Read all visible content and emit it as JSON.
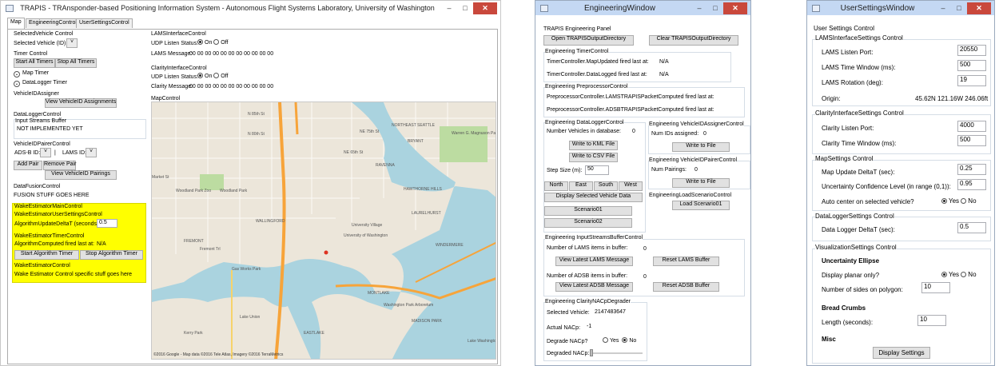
{
  "main": {
    "title": "TRAPIS - TRAnsponder-based Positioning Information System - Autonomous Flight Systems Laboratory, University of Washington",
    "controls": {
      "min": "–",
      "max": "□",
      "close": "✕"
    },
    "tabs": [
      "Map",
      "EngineeringControl",
      "UserSettingsControl"
    ],
    "selected_vehicle": {
      "header": "SelectedVehicle Control",
      "label": "Selected Vehicle (ID):"
    },
    "timer": {
      "header": "Timer Control",
      "start": "Start All Timers",
      "stop": "Stop All Timers",
      "map_timer": "Map Timer",
      "datalogger_timer": "DataLogger Timer"
    },
    "assigner": {
      "header": "VehicleIDAssigner",
      "button": "View VehicleID Assignments"
    },
    "datalogger": {
      "header": "DataLoggerControl",
      "sub": "Input Streams Buffer",
      "text": "NOT IMPLEMENTED YET"
    },
    "pairer": {
      "header": "VehicleIDPairerControl",
      "adsb": "ADS-B ID:",
      "sep": "|",
      "lams": "LAMS ID:",
      "add": "Add Pair",
      "remove": "Remove Pair",
      "view": "View VehicleID Pairings"
    },
    "fusion": {
      "header": "DataFusionControl",
      "text": "FUSION STUFF GOES HERE"
    },
    "wake": {
      "header": "WakeEstimatorMainControl",
      "user_header": "WakeEstimatorUserSettingsControl",
      "delta_label": "AlgorithmUpdateDeltaT (seconds):",
      "delta_value": "0.5",
      "timer_header": "WakeEstimatorTimerControl",
      "computed_label": "AlgorithmComputed fired last at:",
      "computed_value": "N/A",
      "start": "Start Algorithm Timer",
      "stop": "Stop Algorithm Timer",
      "control_header": "WakeEstimatorControl",
      "control_text": "Wake Estimator Control specific stuff goes here"
    },
    "lams": {
      "header": "LAMSInterfaceControl",
      "status_label": "UDP Listen Status:",
      "on": "On",
      "off": "Off",
      "msg_label": "LAMS Message:",
      "msg_value": "00 00 00 00 00 00 00 00 00 00 00"
    },
    "clarity": {
      "header": "ClarityInterfaceControl",
      "status_label": "UDP Listen Status:",
      "on": "On",
      "off": "Off",
      "msg_label": "Clarity Message:",
      "msg_value": "00 00 00 00 00 00 00 00 00 00 00"
    },
    "map": {
      "header": "MapControl",
      "attribution": "©2016 Google - Map data ©2016 Tele Atlas, Imagery ©2016 TerraMetrics",
      "labels": [
        "N 85th St",
        "N 80th St",
        "NE 75th St",
        "NORTHEAST SEATTLE",
        "Warren G. Magnuson Park",
        "NE 65th St",
        "RAVENNA",
        "Market St",
        "Woodland Park Zoo",
        "Woodland Park",
        "FREMONT",
        "WALLINGFORD",
        "University Village",
        "University of Washington",
        "Fremont Trl",
        "Gas Works Park",
        "Lake Union",
        "EASTLAKE",
        "MONTLAKE",
        "Washington Park Arboretum",
        "MADISON PARK",
        "Kerry Park",
        "Lake Washington",
        "LAURELHURST",
        "WINDERMERE",
        "BRYANT",
        "HAWTHORNE HILLS"
      ]
    }
  },
  "eng": {
    "title": "EngineeringWindow",
    "panel": "TRAPIS Engineering Panel",
    "open_dir": "Open TRAPISOutputDirectory",
    "clear_dir": "Clear TRAPISOutputDirectory",
    "timer": {
      "header": "Engineering TimerControl",
      "map_label": "TimerController.MapUpdated fired last at:",
      "map_value": "N/A",
      "log_label": "TimerController.DataLogged fired last at:",
      "log_value": "N/A"
    },
    "pre": {
      "header": "Engineering PreprocessorControl",
      "lams": "PreprocessorController.LAMSTRAPISPacketComputed fired last at:",
      "adsb": "PreprocessorController.ADSBTRAPISPacketComputed fired last at:"
    },
    "dl": {
      "header": "Engineering DataLoggerControl",
      "num_label": "Number Vehicles in database:",
      "num_value": "0",
      "kml": "Write to KML File",
      "csv": "Write to CSV File",
      "step_label": "Step Size (m):",
      "step_value": "50",
      "north": "North",
      "east": "East",
      "south": "South",
      "west": "West",
      "display": "Display Selected Vehicle Data",
      "s1": "Scenario01",
      "s2": "Scenario02"
    },
    "assign": {
      "header": "Engineering VehicleIDAssignerControl",
      "label": "Num IDs assigned:",
      "value": "0",
      "write": "Write to File"
    },
    "pair": {
      "header": "Engineering VehicleIDPairerControl",
      "label": "Num Pairings:",
      "value": "0",
      "write": "Write to File"
    },
    "load": {
      "header": "EngineeringLoadScenarioControl",
      "button": "Load Scenario01"
    },
    "streams": {
      "header": "Engineering InputStreamsBufferControl",
      "lams_label": "Number of LAMS items in buffer:",
      "lams_value": "0",
      "view_lams": "View Latest LAMS Message",
      "reset_lams": "Reset LAMS Buffer",
      "adsb_label": "Number of ADSB items in buffer:",
      "adsb_value": "0",
      "view_adsb": "View Latest ADSB Message",
      "reset_adsb": "Reset ADSB Buffer"
    },
    "nac": {
      "header": "Engineering ClarityNACpDegrader",
      "sel_label": "Selected Vehicle:",
      "sel_value": "2147483647",
      "actual_label": "Actual NACp:",
      "actual_value": "-1",
      "degrade_label": "Degrade NACp?",
      "yes": "Yes",
      "no": "No",
      "degraded_label": "Degraded NACp:"
    }
  },
  "user": {
    "title": "UserSettingsWindow",
    "root": "User Settings Control",
    "lams": {
      "header": "LAMSInterfaceSettings Control",
      "port_label": "LAMS Listen Port:",
      "port_value": "20550",
      "window_label": "LAMS Time Window (ms):",
      "window_value": "500",
      "rot_label": "LAMS Rotation (deg):",
      "rot_value": "19",
      "origin_label": "Origin:",
      "origin_value": "45.62N 121.16W 246.06ft"
    },
    "clarity": {
      "header": "ClarityInterfaceSettings Control",
      "port_label": "Clarity Listen Port:",
      "port_value": "4000",
      "window_label": "Clarity Time Window (ms):",
      "window_value": "500"
    },
    "map": {
      "header": "MapSettings Control",
      "delta_label": "Map Update DeltaT (sec):",
      "delta_value": "0.25",
      "conf_label": "Uncertainty Confidence Level (in range (0,1)):",
      "conf_value": "0.95",
      "auto_label": "Auto center on selected vehicle?",
      "yes": "Yes",
      "no": "No"
    },
    "dl": {
      "header": "DataLoggerSettings Control",
      "delta_label": "Data Logger DeltaT (sec):",
      "delta_value": "0.5"
    },
    "vis": {
      "header": "VisualizationSettings Control",
      "ellipse": "Uncertainty Ellipse",
      "planar_label": "Display planar only?",
      "yes": "Yes",
      "no": "No",
      "sides_label": "Number of sides on polygon:",
      "sides_value": "10",
      "crumbs": "Bread Crumbs",
      "length_label": "Length (seconds):",
      "length_value": "10",
      "misc": "Misc",
      "display": "Display Settings"
    }
  }
}
